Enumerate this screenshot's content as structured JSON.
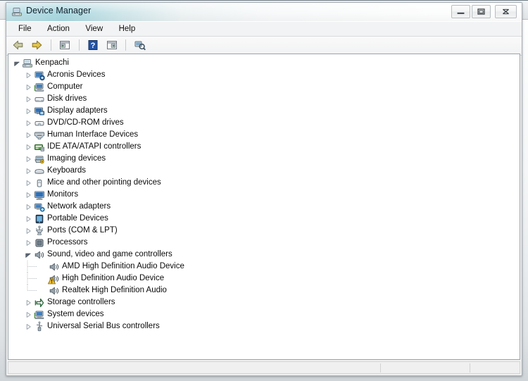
{
  "window": {
    "title": "Device Manager",
    "app_icon": "device-manager-icon",
    "controls": {
      "minimize": "Minimize",
      "maximize": "Maximize",
      "close": "Close"
    }
  },
  "menubar": {
    "items": [
      {
        "label": "File"
      },
      {
        "label": "Action"
      },
      {
        "label": "View"
      },
      {
        "label": "Help"
      }
    ]
  },
  "toolbar": {
    "buttons": [
      {
        "name": "back-button",
        "icon": "back-arrow-icon",
        "tooltip": "Back"
      },
      {
        "name": "forward-button",
        "icon": "forward-arrow-icon",
        "tooltip": "Forward"
      },
      {
        "name": "show-hide-console-tree-button",
        "icon": "console-tree-icon",
        "tooltip": "Show/Hide Console Tree"
      },
      {
        "name": "help-button",
        "icon": "help-question-icon",
        "tooltip": "Help"
      },
      {
        "name": "properties-button",
        "icon": "properties-icon",
        "tooltip": "Properties"
      },
      {
        "name": "scan-hardware-changes-button",
        "icon": "scan-hardware-icon",
        "tooltip": "Scan for hardware changes"
      }
    ]
  },
  "tree": {
    "root": {
      "label": "Kenpachi",
      "icon": "computer-root-icon",
      "expanded": true,
      "depth": 0
    },
    "nodes": [
      {
        "label": "Acronis Devices",
        "icon": "acronis-devices-icon",
        "expanded": false,
        "depth": 1,
        "warning": false
      },
      {
        "label": "Computer",
        "icon": "computer-icon",
        "expanded": false,
        "depth": 1,
        "warning": false
      },
      {
        "label": "Disk drives",
        "icon": "disk-drive-icon",
        "expanded": false,
        "depth": 1,
        "warning": false
      },
      {
        "label": "Display adapters",
        "icon": "display-adapter-icon",
        "expanded": false,
        "depth": 1,
        "warning": false
      },
      {
        "label": "DVD/CD-ROM drives",
        "icon": "dvd-cdrom-icon",
        "expanded": false,
        "depth": 1,
        "warning": false
      },
      {
        "label": "Human Interface Devices",
        "icon": "hid-icon",
        "expanded": false,
        "depth": 1,
        "warning": false
      },
      {
        "label": "IDE ATA/ATAPI controllers",
        "icon": "ide-controller-icon",
        "expanded": false,
        "depth": 1,
        "warning": false
      },
      {
        "label": "Imaging devices",
        "icon": "imaging-device-icon",
        "expanded": false,
        "depth": 1,
        "warning": false
      },
      {
        "label": "Keyboards",
        "icon": "keyboard-icon",
        "expanded": false,
        "depth": 1,
        "warning": false
      },
      {
        "label": "Mice and other pointing devices",
        "icon": "mouse-icon",
        "expanded": false,
        "depth": 1,
        "warning": false
      },
      {
        "label": "Monitors",
        "icon": "monitor-icon",
        "expanded": false,
        "depth": 1,
        "warning": false
      },
      {
        "label": "Network adapters",
        "icon": "network-adapter-icon",
        "expanded": false,
        "depth": 1,
        "warning": false
      },
      {
        "label": "Portable Devices",
        "icon": "portable-device-icon",
        "expanded": false,
        "depth": 1,
        "warning": false
      },
      {
        "label": "Ports (COM & LPT)",
        "icon": "port-icon",
        "expanded": false,
        "depth": 1,
        "warning": false
      },
      {
        "label": "Processors",
        "icon": "processor-icon",
        "expanded": false,
        "depth": 1,
        "warning": false
      },
      {
        "label": "Sound, video and game controllers",
        "icon": "sound-controller-icon",
        "expanded": true,
        "depth": 1,
        "warning": false
      },
      {
        "label": "AMD High Definition Audio Device",
        "icon": "speaker-icon",
        "expanded": null,
        "depth": 2,
        "warning": false
      },
      {
        "label": "High Definition Audio Device",
        "icon": "speaker-icon",
        "expanded": null,
        "depth": 2,
        "warning": true
      },
      {
        "label": "Realtek High Definition Audio",
        "icon": "speaker-icon",
        "expanded": null,
        "depth": 2,
        "warning": false
      },
      {
        "label": "Storage controllers",
        "icon": "storage-controller-icon",
        "expanded": false,
        "depth": 1,
        "warning": false
      },
      {
        "label": "System devices",
        "icon": "system-device-icon",
        "expanded": false,
        "depth": 1,
        "warning": false
      },
      {
        "label": "Universal Serial Bus controllers",
        "icon": "usb-controller-icon",
        "expanded": false,
        "depth": 1,
        "warning": false
      }
    ]
  },
  "statusbar": {
    "panel1": "",
    "panel2": "",
    "panel3": ""
  },
  "colors": {
    "titlebar_accent": "#a9d7e0",
    "warning": "#f2c029",
    "window_border": "#a6aeb4",
    "tree_background": "#ffffff",
    "selection": "#d6e8f7"
  }
}
